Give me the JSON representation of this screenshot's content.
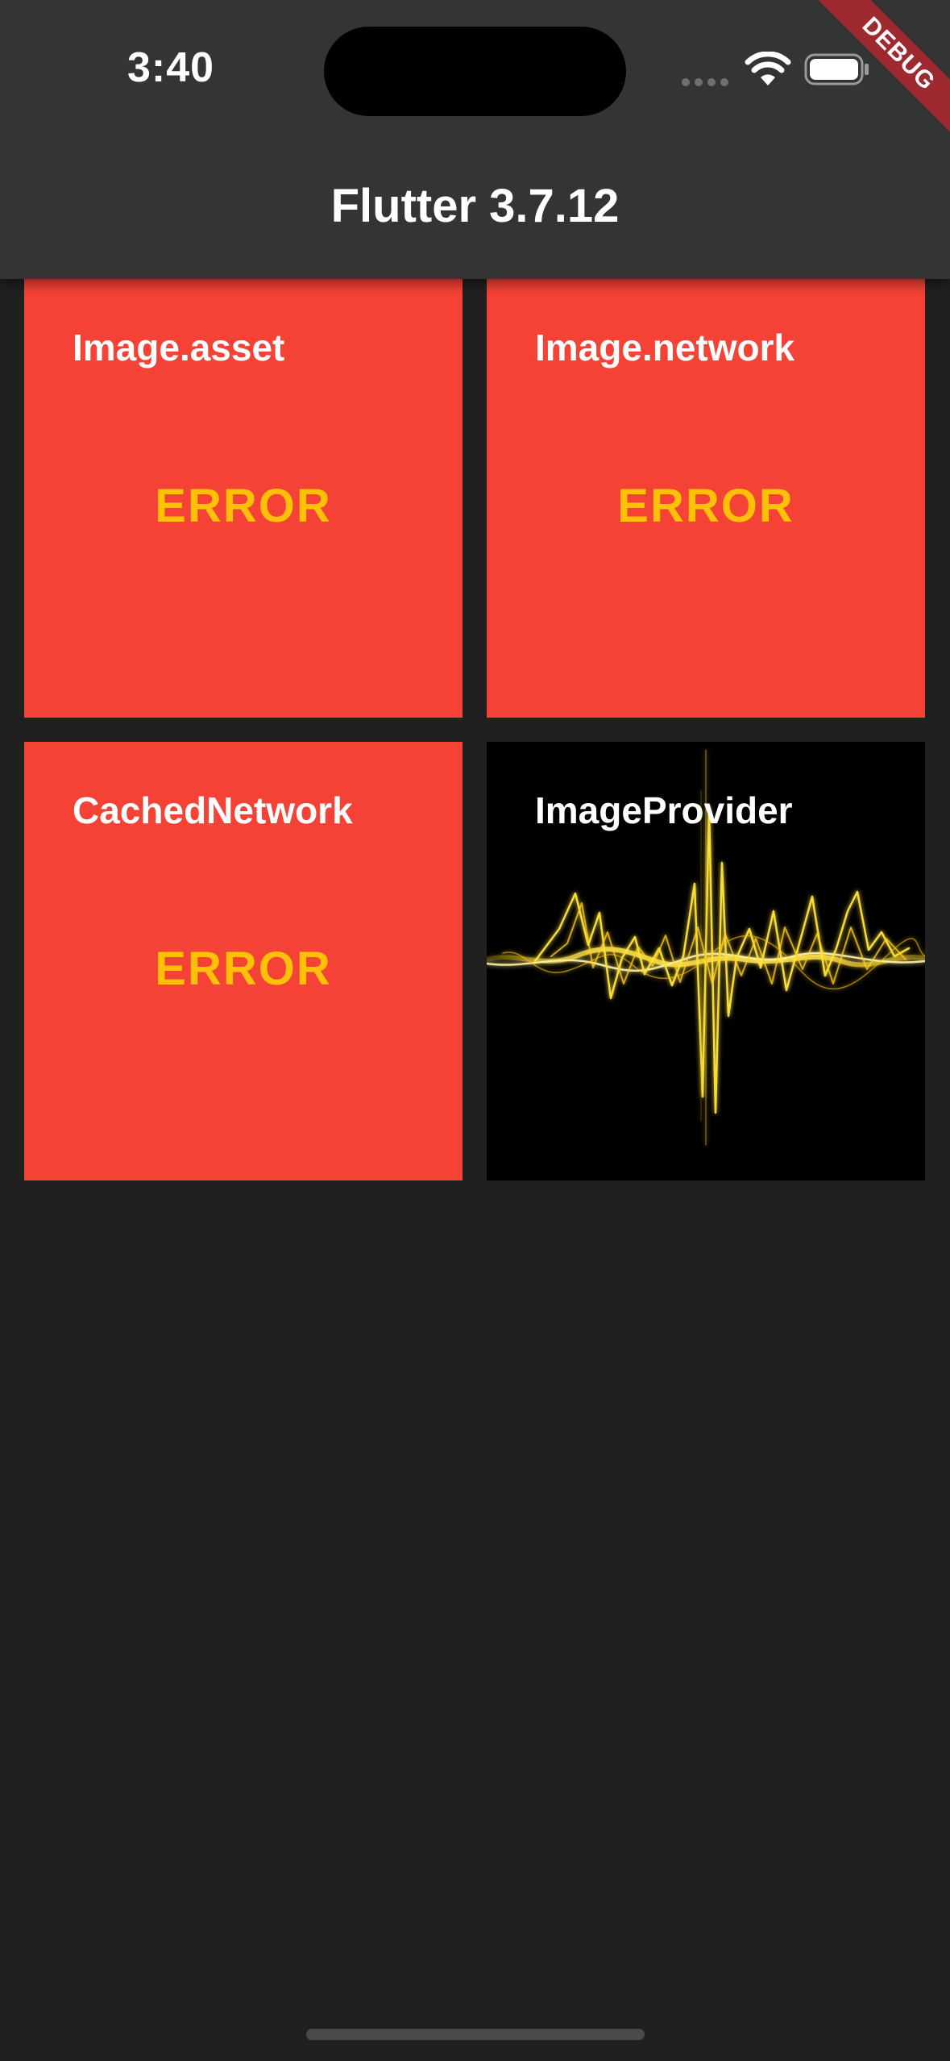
{
  "status_bar": {
    "time": "3:40"
  },
  "app_bar": {
    "title": "Flutter 3.7.12"
  },
  "debug_banner": {
    "label": "DEBUG"
  },
  "tiles": [
    {
      "label": "Image.asset",
      "state": "ERROR"
    },
    {
      "label": "Image.network",
      "state": "ERROR"
    },
    {
      "label": "CachedNetwork",
      "state": "ERROR"
    },
    {
      "label": "ImageProvider"
    }
  ],
  "colors": {
    "app_bar": "#343434",
    "background": "#202020",
    "tile_error_bg": "#f44336",
    "error_text": "#ffc107",
    "debug_banner": "#9e2a2f"
  },
  "icons": [
    "wifi-icon",
    "battery-icon",
    "cellular-signal-icon"
  ]
}
